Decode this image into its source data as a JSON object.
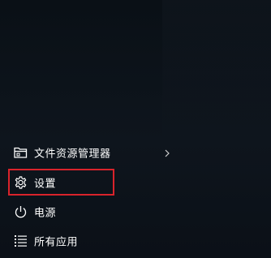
{
  "start_menu": {
    "items": [
      {
        "label": "文件资源管理器",
        "icon": "file-explorer-icon",
        "has_submenu": true
      },
      {
        "label": "设置",
        "icon": "gear-icon",
        "has_submenu": false
      },
      {
        "label": "电源",
        "icon": "power-icon",
        "has_submenu": false
      },
      {
        "label": "所有应用",
        "icon": "all-apps-icon",
        "has_submenu": false
      }
    ],
    "highlight": {
      "item": "设置",
      "color": "#d9232b"
    }
  },
  "colors": {
    "background": "#0b1118",
    "text": "#ffffff",
    "highlight": "#d9232b"
  }
}
